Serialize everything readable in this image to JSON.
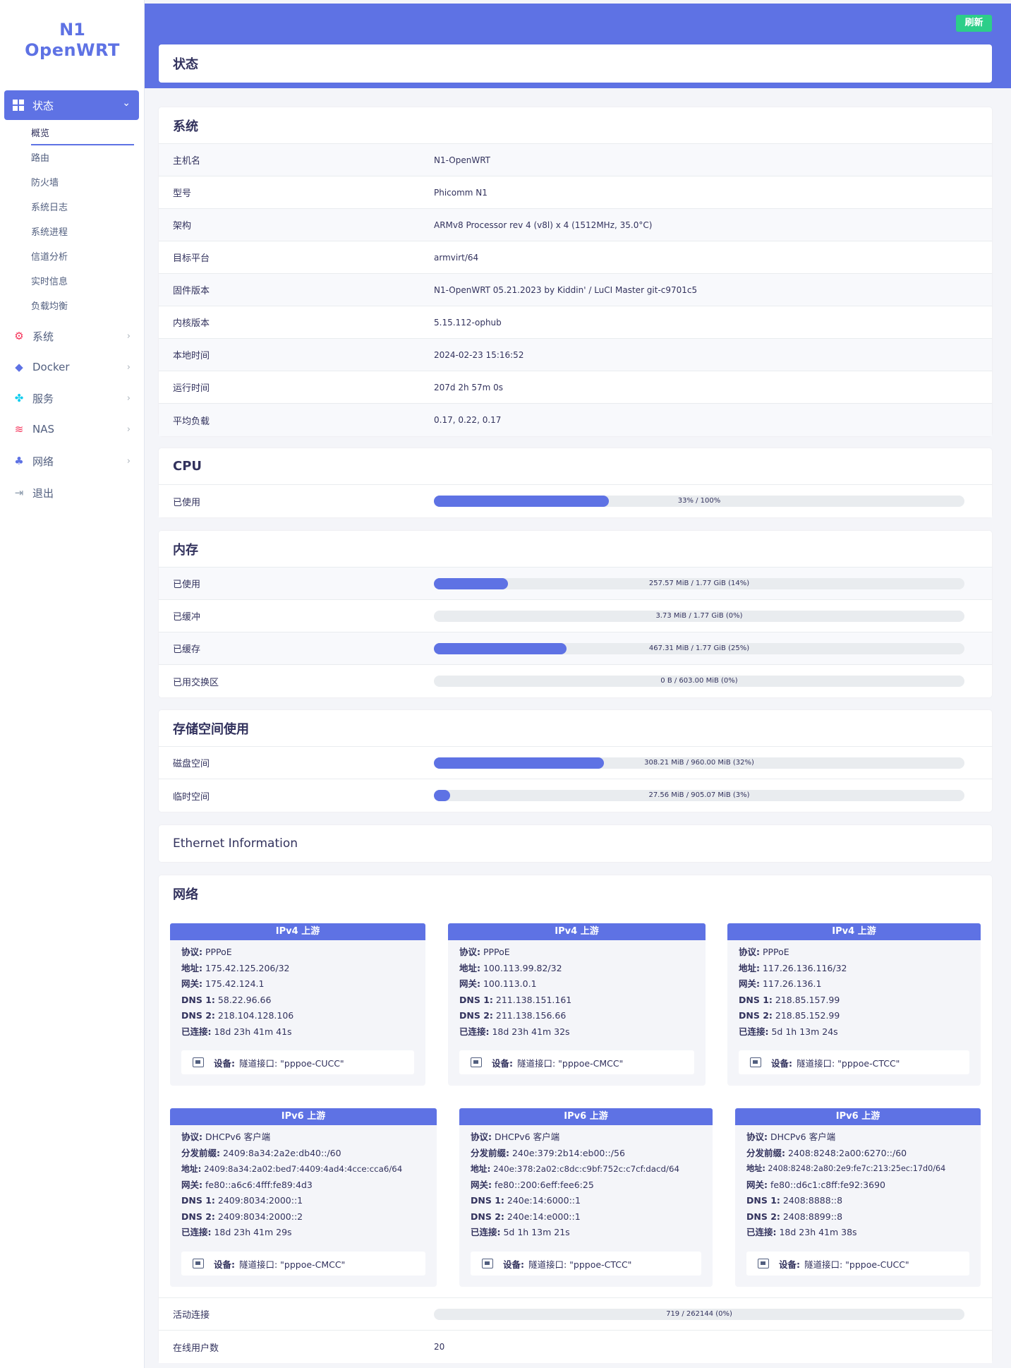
{
  "brand": {
    "line1": "N1",
    "line2": "OpenWRT"
  },
  "sidebar": {
    "active": "状态",
    "submenu": [
      "概览",
      "路由",
      "防火墙",
      "系统日志",
      "系统进程",
      "信道分析",
      "实时信息",
      "负载均衡"
    ],
    "items": [
      {
        "label": "系统",
        "icon": "gear-icon"
      },
      {
        "label": "Docker",
        "icon": "docker-icon"
      },
      {
        "label": "服务",
        "icon": "services-icon"
      },
      {
        "label": "NAS",
        "icon": "database-icon"
      },
      {
        "label": "网络",
        "icon": "network-icon"
      },
      {
        "label": "退出",
        "icon": "logout-icon"
      }
    ]
  },
  "header": {
    "refresh_label": "刷新",
    "page_title": "状态"
  },
  "system": {
    "title": "系统",
    "rows": [
      {
        "k": "主机名",
        "v": "N1-OpenWRT"
      },
      {
        "k": "型号",
        "v": "Phicomm N1"
      },
      {
        "k": "架构",
        "v": "ARMv8 Processor rev 4 (v8l) x 4 (1512MHz, 35.0°C)"
      },
      {
        "k": "目标平台",
        "v": "armvirt/64"
      },
      {
        "k": "固件版本",
        "v": "N1-OpenWRT 05.21.2023 by Kiddin' / LuCI Master git-c9701c5"
      },
      {
        "k": "内核版本",
        "v": "5.15.112-ophub"
      },
      {
        "k": "本地时间",
        "v": "2024-02-23 15:16:52"
      },
      {
        "k": "运行时间",
        "v": "207d 2h 57m 0s"
      },
      {
        "k": "平均负载",
        "v": "0.17, 0.22, 0.17"
      }
    ]
  },
  "cpu": {
    "title": "CPU",
    "rows": [
      {
        "k": "已使用",
        "text": "33% / 100%",
        "pct": 33
      }
    ]
  },
  "memory": {
    "title": "内存",
    "rows": [
      {
        "k": "已使用",
        "text": "257.57 MiB / 1.77 GiB (14%)",
        "pct": 14
      },
      {
        "k": "已缓冲",
        "text": "3.73 MiB / 1.77 GiB (0%)",
        "pct": 0
      },
      {
        "k": "已缓存",
        "text": "467.31 MiB / 1.77 GiB (25%)",
        "pct": 25
      },
      {
        "k": "已用交换区",
        "text": "0 B / 603.00 MiB (0%)",
        "pct": 0
      }
    ]
  },
  "storage": {
    "title": "存储空间使用",
    "rows": [
      {
        "k": "磁盘空间",
        "text": "308.21 MiB / 960.00 MiB (32%)",
        "pct": 32
      },
      {
        "k": "临时空间",
        "text": "27.56 MiB / 905.07 MiB (3%)",
        "pct": 3
      }
    ]
  },
  "ethernet": {
    "title": "Ethernet Information"
  },
  "network": {
    "title": "网络",
    "ipv4": [
      {
        "head": "IPv4 上游",
        "lines": [
          [
            "协议:",
            "PPPoE"
          ],
          [
            "地址:",
            "175.42.125.206/32"
          ],
          [
            "网关:",
            "175.42.124.1"
          ],
          [
            "DNS 1:",
            "58.22.96.66"
          ],
          [
            "DNS 2:",
            "218.104.128.106"
          ],
          [
            "已连接:",
            "18d 23h 41m 41s"
          ]
        ],
        "device": [
          "设备:",
          "隧道接口: \"pppoe-CUCC\""
        ]
      },
      {
        "head": "IPv4 上游",
        "lines": [
          [
            "协议:",
            "PPPoE"
          ],
          [
            "地址:",
            "100.113.99.82/32"
          ],
          [
            "网关:",
            "100.113.0.1"
          ],
          [
            "DNS 1:",
            "211.138.151.161"
          ],
          [
            "DNS 2:",
            "211.138.156.66"
          ],
          [
            "已连接:",
            "18d 23h 41m 32s"
          ]
        ],
        "device": [
          "设备:",
          "隧道接口: \"pppoe-CMCC\""
        ]
      },
      {
        "head": "IPv4 上游",
        "lines": [
          [
            "协议:",
            "PPPoE"
          ],
          [
            "地址:",
            "117.26.136.116/32"
          ],
          [
            "网关:",
            "117.26.136.1"
          ],
          [
            "DNS 1:",
            "218.85.157.99"
          ],
          [
            "DNS 2:",
            "218.85.152.99"
          ],
          [
            "已连接:",
            "5d 1h 13m 24s"
          ]
        ],
        "device": [
          "设备:",
          "隧道接口: \"pppoe-CTCC\""
        ]
      }
    ],
    "ipv6": [
      {
        "head": "IPv6 上游",
        "lines": [
          [
            "协议:",
            "DHCPv6 客户端"
          ],
          [
            "分发前缀:",
            "2409:8a34:2a2e:db40::/60"
          ],
          [
            "地址:",
            "2409:8a34:2a02:bed7:4409:4ad4:4cce:cca6/64"
          ],
          [
            "网关:",
            "fe80::a6c6:4fff:fe89:4d3"
          ],
          [
            "DNS 1:",
            "2409:8034:2000::1"
          ],
          [
            "DNS 2:",
            "2409:8034:2000::2"
          ],
          [
            "已连接:",
            "18d 23h 41m 29s"
          ]
        ],
        "device": [
          "设备:",
          "隧道接口: \"pppoe-CMCC\""
        ]
      },
      {
        "head": "IPv6 上游",
        "lines": [
          [
            "协议:",
            "DHCPv6 客户端"
          ],
          [
            "分发前缀:",
            "240e:379:2b14:eb00::/56"
          ],
          [
            "地址:",
            "240e:378:2a02:c8dc:c9bf:752c:c7cf:dacd/64"
          ],
          [
            "网关:",
            "fe80::200:6eff:fee6:25"
          ],
          [
            "DNS 1:",
            "240e:14:6000::1"
          ],
          [
            "DNS 2:",
            "240e:14:e000::1"
          ],
          [
            "已连接:",
            "5d 1h 13m 21s"
          ]
        ],
        "device": [
          "设备:",
          "隧道接口: \"pppoe-CTCC\""
        ]
      },
      {
        "head": "IPv6 上游",
        "lines": [
          [
            "协议:",
            "DHCPv6 客户端"
          ],
          [
            "分发前缀:",
            "2408:8248:2a00:6270::/60"
          ],
          [
            "地址:",
            "2408:8248:2a80:2e9:fe7c:213:25ec:17d0/64"
          ],
          [
            "网关:",
            "fe80::d6c1:c8ff:fe92:3690"
          ],
          [
            "DNS 1:",
            "2408:8888::8"
          ],
          [
            "DNS 2:",
            "2408:8899::8"
          ],
          [
            "已连接:",
            "18d 23h 41m 38s"
          ]
        ],
        "device": [
          "设备:",
          "隧道接口: \"pppoe-CUCC\""
        ]
      }
    ],
    "active_conn": {
      "k": "活动连接",
      "text": "719 / 262144 (0%)",
      "pct": 0
    },
    "online_users": {
      "k": "在线用户数",
      "v": "20"
    }
  }
}
